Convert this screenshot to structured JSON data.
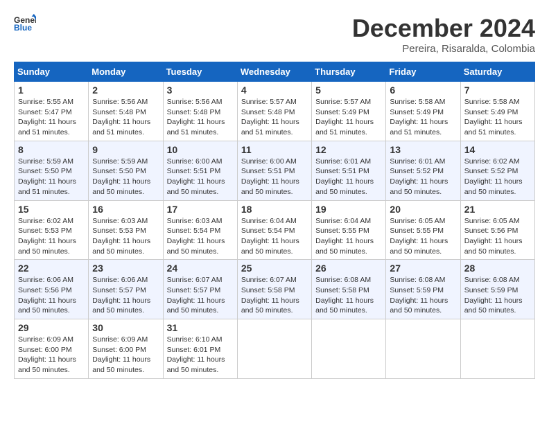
{
  "header": {
    "logo_general": "General",
    "logo_blue": "Blue",
    "month_title": "December 2024",
    "location": "Pereira, Risaralda, Colombia"
  },
  "weekdays": [
    "Sunday",
    "Monday",
    "Tuesday",
    "Wednesday",
    "Thursday",
    "Friday",
    "Saturday"
  ],
  "weeks": [
    [
      {
        "day": "1",
        "sunrise": "5:55 AM",
        "sunset": "5:47 PM",
        "daylight": "11 hours and 51 minutes."
      },
      {
        "day": "2",
        "sunrise": "5:56 AM",
        "sunset": "5:48 PM",
        "daylight": "11 hours and 51 minutes."
      },
      {
        "day": "3",
        "sunrise": "5:56 AM",
        "sunset": "5:48 PM",
        "daylight": "11 hours and 51 minutes."
      },
      {
        "day": "4",
        "sunrise": "5:57 AM",
        "sunset": "5:48 PM",
        "daylight": "11 hours and 51 minutes."
      },
      {
        "day": "5",
        "sunrise": "5:57 AM",
        "sunset": "5:49 PM",
        "daylight": "11 hours and 51 minutes."
      },
      {
        "day": "6",
        "sunrise": "5:58 AM",
        "sunset": "5:49 PM",
        "daylight": "11 hours and 51 minutes."
      },
      {
        "day": "7",
        "sunrise": "5:58 AM",
        "sunset": "5:49 PM",
        "daylight": "11 hours and 51 minutes."
      }
    ],
    [
      {
        "day": "8",
        "sunrise": "5:59 AM",
        "sunset": "5:50 PM",
        "daylight": "11 hours and 51 minutes."
      },
      {
        "day": "9",
        "sunrise": "5:59 AM",
        "sunset": "5:50 PM",
        "daylight": "11 hours and 50 minutes."
      },
      {
        "day": "10",
        "sunrise": "6:00 AM",
        "sunset": "5:51 PM",
        "daylight": "11 hours and 50 minutes."
      },
      {
        "day": "11",
        "sunrise": "6:00 AM",
        "sunset": "5:51 PM",
        "daylight": "11 hours and 50 minutes."
      },
      {
        "day": "12",
        "sunrise": "6:01 AM",
        "sunset": "5:51 PM",
        "daylight": "11 hours and 50 minutes."
      },
      {
        "day": "13",
        "sunrise": "6:01 AM",
        "sunset": "5:52 PM",
        "daylight": "11 hours and 50 minutes."
      },
      {
        "day": "14",
        "sunrise": "6:02 AM",
        "sunset": "5:52 PM",
        "daylight": "11 hours and 50 minutes."
      }
    ],
    [
      {
        "day": "15",
        "sunrise": "6:02 AM",
        "sunset": "5:53 PM",
        "daylight": "11 hours and 50 minutes."
      },
      {
        "day": "16",
        "sunrise": "6:03 AM",
        "sunset": "5:53 PM",
        "daylight": "11 hours and 50 minutes."
      },
      {
        "day": "17",
        "sunrise": "6:03 AM",
        "sunset": "5:54 PM",
        "daylight": "11 hours and 50 minutes."
      },
      {
        "day": "18",
        "sunrise": "6:04 AM",
        "sunset": "5:54 PM",
        "daylight": "11 hours and 50 minutes."
      },
      {
        "day": "19",
        "sunrise": "6:04 AM",
        "sunset": "5:55 PM",
        "daylight": "11 hours and 50 minutes."
      },
      {
        "day": "20",
        "sunrise": "6:05 AM",
        "sunset": "5:55 PM",
        "daylight": "11 hours and 50 minutes."
      },
      {
        "day": "21",
        "sunrise": "6:05 AM",
        "sunset": "5:56 PM",
        "daylight": "11 hours and 50 minutes."
      }
    ],
    [
      {
        "day": "22",
        "sunrise": "6:06 AM",
        "sunset": "5:56 PM",
        "daylight": "11 hours and 50 minutes."
      },
      {
        "day": "23",
        "sunrise": "6:06 AM",
        "sunset": "5:57 PM",
        "daylight": "11 hours and 50 minutes."
      },
      {
        "day": "24",
        "sunrise": "6:07 AM",
        "sunset": "5:57 PM",
        "daylight": "11 hours and 50 minutes."
      },
      {
        "day": "25",
        "sunrise": "6:07 AM",
        "sunset": "5:58 PM",
        "daylight": "11 hours and 50 minutes."
      },
      {
        "day": "26",
        "sunrise": "6:08 AM",
        "sunset": "5:58 PM",
        "daylight": "11 hours and 50 minutes."
      },
      {
        "day": "27",
        "sunrise": "6:08 AM",
        "sunset": "5:59 PM",
        "daylight": "11 hours and 50 minutes."
      },
      {
        "day": "28",
        "sunrise": "6:08 AM",
        "sunset": "5:59 PM",
        "daylight": "11 hours and 50 minutes."
      }
    ],
    [
      {
        "day": "29",
        "sunrise": "6:09 AM",
        "sunset": "6:00 PM",
        "daylight": "11 hours and 50 minutes."
      },
      {
        "day": "30",
        "sunrise": "6:09 AM",
        "sunset": "6:00 PM",
        "daylight": "11 hours and 50 minutes."
      },
      {
        "day": "31",
        "sunrise": "6:10 AM",
        "sunset": "6:01 PM",
        "daylight": "11 hours and 50 minutes."
      },
      null,
      null,
      null,
      null
    ]
  ]
}
